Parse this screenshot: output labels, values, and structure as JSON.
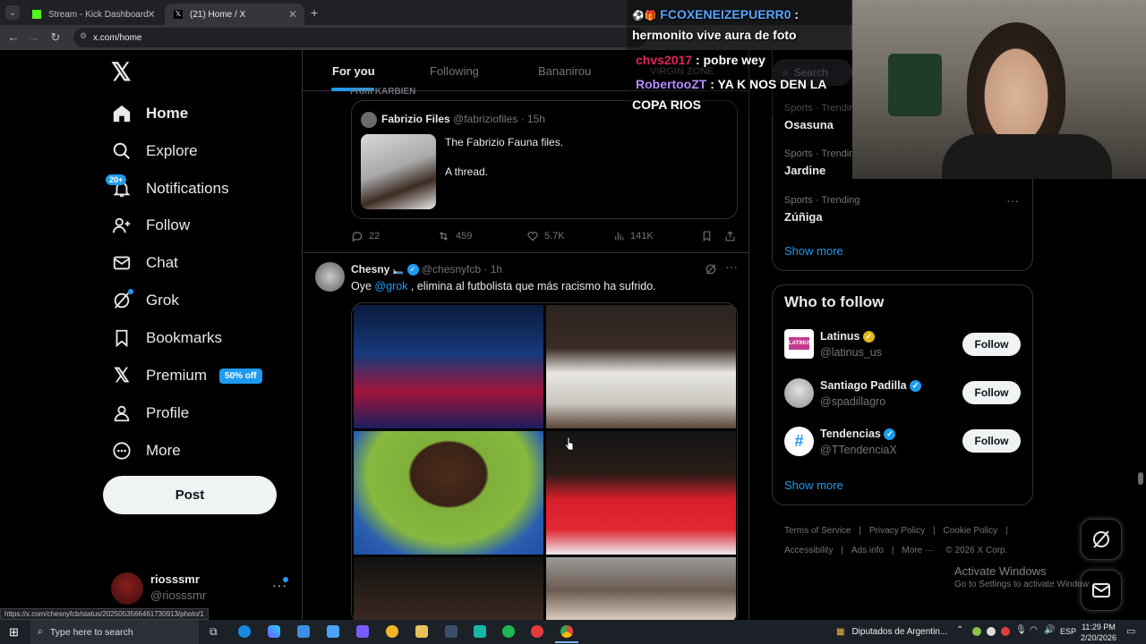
{
  "browser": {
    "tabs": [
      {
        "label": "Stream - Kick Dashboard",
        "active": false
      },
      {
        "label": "(21) Home / X",
        "active": true
      }
    ],
    "url": "x.com/home",
    "status_url": "https://x.com/chesnyfcb/status/2025053566461730913/photo/1"
  },
  "sidebar": {
    "items": [
      {
        "label": "Home",
        "icon": "home-icon"
      },
      {
        "label": "Explore",
        "icon": "search-icon"
      },
      {
        "label": "Notifications",
        "icon": "bell-icon",
        "badge": "20+"
      },
      {
        "label": "Follow",
        "icon": "person-add-icon"
      },
      {
        "label": "Chat",
        "icon": "mail-icon"
      },
      {
        "label": "Grok",
        "icon": "grok-icon"
      },
      {
        "label": "Bookmarks",
        "icon": "bookmark-icon"
      },
      {
        "label": "Premium",
        "icon": "x-logo-icon",
        "badge": "50% off"
      },
      {
        "label": "Profile",
        "icon": "person-icon"
      },
      {
        "label": "More",
        "icon": "more-circle-icon"
      }
    ],
    "post_label": "Post",
    "account": {
      "name": "riosssmr",
      "handle": "@riosssmr"
    }
  },
  "main": {
    "tabs": [
      "For you",
      "Following",
      "Bananirou",
      "VIRGIN ZONE"
    ],
    "from_label": "From KARBIEN",
    "quote": {
      "author": "Fabrizio Files",
      "handle": "@fabriziofiles",
      "time": "· 15h",
      "line1": "The Fabrizio Fauna files.",
      "line2": "A thread."
    },
    "actions": {
      "replies": "22",
      "reposts": "459",
      "likes": "5.7K",
      "views": "141K"
    },
    "tweet": {
      "author": "Chesny",
      "handle": "@chesnyfcb",
      "time": "· 1h",
      "text_pre": "Oye ",
      "mention": "@grok",
      "text_post": " , elimina al futbolista que más racismo ha sufrido."
    }
  },
  "right": {
    "search_placeholder": "Search",
    "trends": [
      {
        "category": "Sports · Trending",
        "name": "Osasuna"
      },
      {
        "category": "Sports · Trending",
        "name": "Jardine"
      },
      {
        "category": "Sports · Trending",
        "name": "Zúñiga"
      }
    ],
    "show_more": "Show more",
    "who_to_follow_title": "Who to follow",
    "suggestions": [
      {
        "name": "Latinus",
        "handle": "@latinus_us",
        "verified": "gold"
      },
      {
        "name": "Santiago Padilla",
        "handle": "@spadillagro",
        "verified": "blue"
      },
      {
        "name": "Tendencias",
        "handle": "@TTendenciaX",
        "verified": "blue"
      }
    ],
    "follow_label": "Follow",
    "footer": [
      "Terms of Service",
      "|",
      "Privacy Policy",
      "|",
      "Cookie Policy",
      "|",
      "Accessibility",
      "|",
      "Ads info",
      "|",
      "More ···",
      "© 2026 X Corp."
    ]
  },
  "chat": [
    {
      "user": "FCOXENEIZEPUERR0",
      "sep": " :",
      "color": "#58a6ff"
    },
    {
      "text": "hermonito vive aura de foto"
    },
    {
      "user": "chvs2017",
      "sep": " : pobre wey",
      "color": "#e0245e"
    },
    {
      "user": "RobertooZT",
      "sep": " : YA K NOS DEN LA",
      "color": "#b58cff"
    },
    {
      "text": "COPA RIOS"
    }
  ],
  "watermark": {
    "title": "Activate Windows",
    "subtitle": "Go to Settings to activate Windows."
  },
  "taskbar": {
    "search_placeholder": "Type here to search",
    "active_app": "Diputados de Argentin...",
    "lang": "ESP",
    "time": "11:29 PM",
    "date": "2/20/2026"
  },
  "colors": {
    "accent": "#1d9bf0",
    "bg": "#000000",
    "border": "#2f3336"
  }
}
